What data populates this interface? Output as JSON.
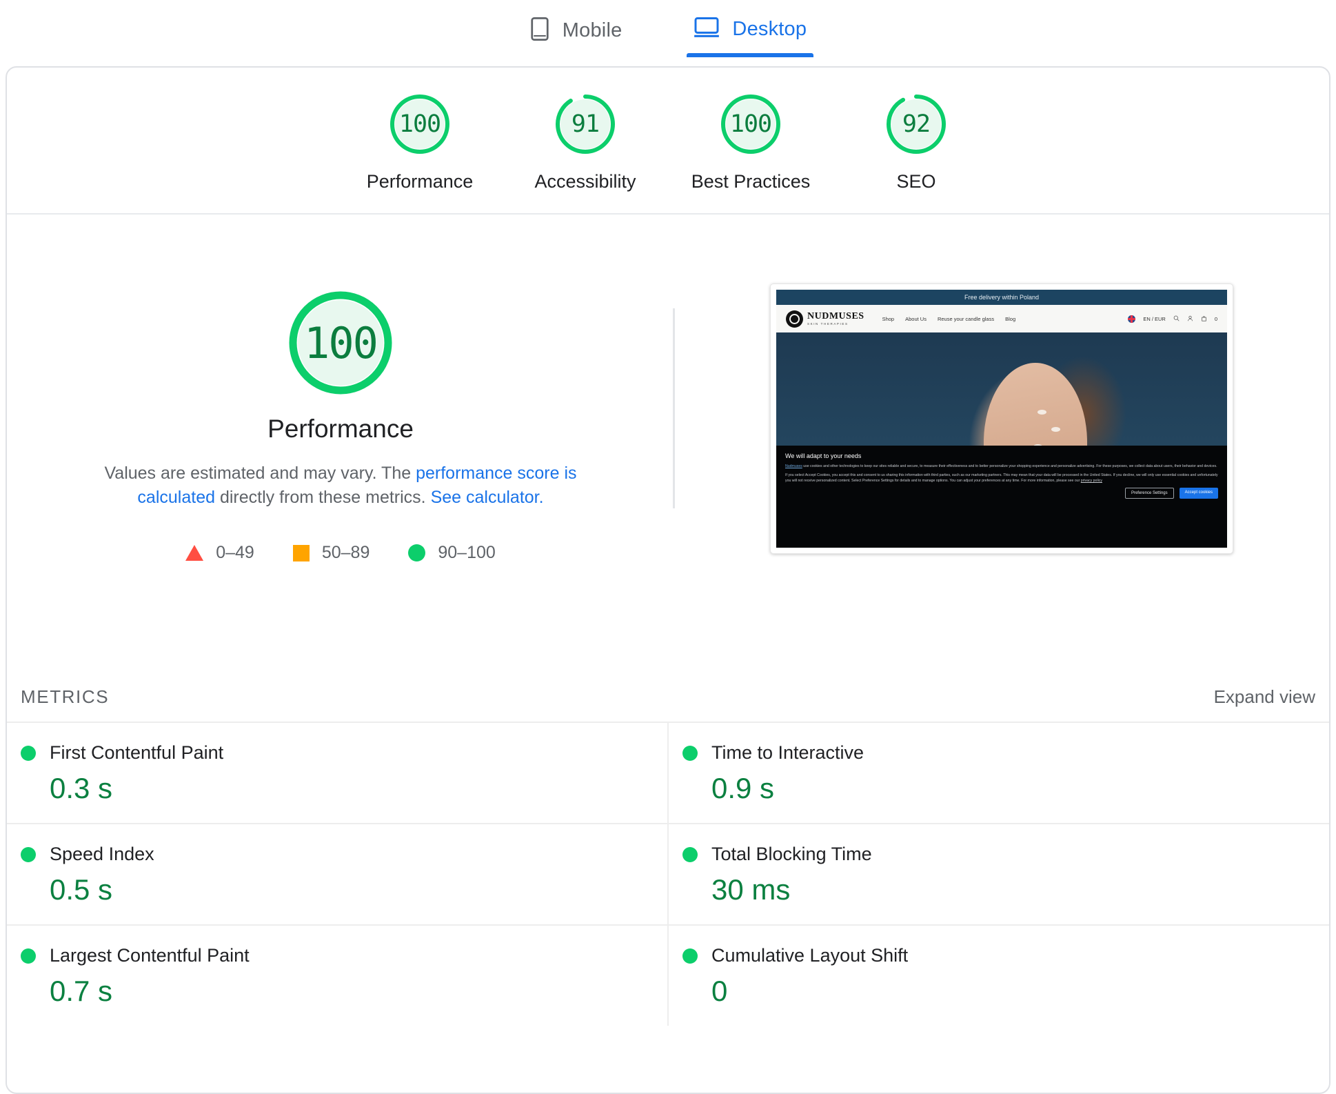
{
  "tabs": [
    {
      "id": "mobile",
      "label": "Mobile",
      "icon": "mobile-icon",
      "active": false
    },
    {
      "id": "desktop",
      "label": "Desktop",
      "icon": "desktop-icon",
      "active": true
    }
  ],
  "colors": {
    "pass_green": "#0cce6b",
    "pass_green_dark": "#0b7d3e",
    "average_orange": "#ffa400",
    "fail_red": "#ff4e42",
    "link_blue": "#1a73e8"
  },
  "scores": [
    {
      "label": "Performance",
      "value": "100",
      "pct": 100
    },
    {
      "label": "Accessibility",
      "value": "91",
      "pct": 91
    },
    {
      "label": "Best Practices",
      "value": "100",
      "pct": 100
    },
    {
      "label": "SEO",
      "value": "92",
      "pct": 92
    }
  ],
  "performance_panel": {
    "score": "100",
    "title": "Performance",
    "description_prefix": "Values are estimated and may vary. The ",
    "link_1": "performance score is calculated",
    "description_middle": " directly from these metrics. ",
    "link_2": "See calculator.",
    "legend": [
      {
        "shape": "triangle",
        "label": "0–49",
        "color": "#ff4e42"
      },
      {
        "shape": "square",
        "label": "50–89",
        "color": "#ffa400"
      },
      {
        "shape": "circle",
        "label": "90–100",
        "color": "#0cce6b"
      }
    ]
  },
  "thumbnail": {
    "announcement": "Free delivery within Poland",
    "brand_name": "NUDMUSES",
    "brand_tagline": "SKIN THERAPIES",
    "nav_links": [
      "Shop",
      "About Us",
      "Reuse your candle glass",
      "Blog"
    ],
    "locale": "EN / EUR",
    "cart_count": "0",
    "cookie": {
      "title": "We will adapt to your needs",
      "brand_link": "Nudmuses",
      "paragraph_1": " use cookies and other technologies to keep our sites reliable and secure, to measure their effectiveness and to better personalize your shopping experience and personalize advertising. For these purposes, we collect data about users, their behavior and devices.",
      "paragraph_2": "If you select Accept Cookies, you accept this and consent to us sharing this information with third parties, such as our marketing partners. This may mean that your data will be processed in the United States. If you decline, we will only use essential cookies and unfortunately you will not receive personalized content. Select Preference Settings for details and to manage options. You can adjust your preferences at any time. For more information, please see our ",
      "privacy_link": "privacy policy",
      "btn_preference": "Preference Settings",
      "btn_accept": "Accept cookies"
    }
  },
  "metrics_section": {
    "title": "METRICS",
    "expand_label": "Expand view",
    "left_column": [
      {
        "name": "First Contentful Paint",
        "value": "0.3 s",
        "status": "pass"
      },
      {
        "name": "Speed Index",
        "value": "0.5 s",
        "status": "pass"
      },
      {
        "name": "Largest Contentful Paint",
        "value": "0.7 s",
        "status": "pass"
      }
    ],
    "right_column": [
      {
        "name": "Time to Interactive",
        "value": "0.9 s",
        "status": "pass"
      },
      {
        "name": "Total Blocking Time",
        "value": "30 ms",
        "status": "pass"
      },
      {
        "name": "Cumulative Layout Shift",
        "value": "0",
        "status": "pass"
      }
    ]
  }
}
